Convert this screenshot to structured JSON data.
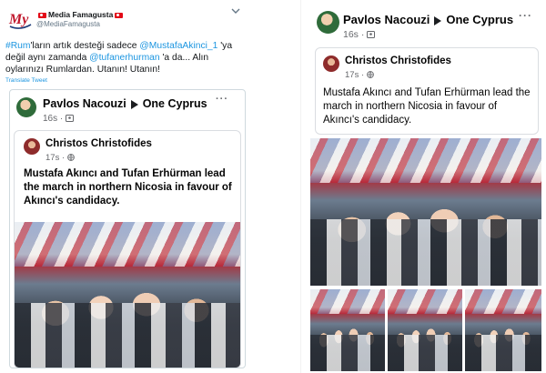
{
  "tweet": {
    "account_name": "Media Famagusta",
    "account_handle": "@MediaFamagusta",
    "logo_text": "My",
    "text_parts": [
      {
        "t": "#Rum",
        "link": true
      },
      {
        "t": "'ların artık desteği sadece ",
        "link": false
      },
      {
        "t": "@MustafaAkinci_1",
        "link": true
      },
      {
        "t": " 'ya değil aynı zamanda ",
        "link": false
      },
      {
        "t": "@tufanerhurman",
        "link": true
      },
      {
        "t": " 'a da... Alın oylarınızı Rumlardan. Utanın! Utanın!",
        "link": false
      }
    ],
    "translate_label": "Translate Tweet",
    "more_icon": "chevron-down-icon"
  },
  "fb_post": {
    "author": "Pavlos Nacouzi",
    "group": "One Cyprus",
    "time": "16s",
    "privacy_icon": "group-icon",
    "shared_author": "Christos Christofides",
    "shared_time": "17s",
    "shared_privacy_icon": "globe-icon",
    "body": "Mustafa Akıncı and Tufan Erhürman lead the march in northern Nicosia in favour of Akıncı's candidacy.",
    "more_icon": "ellipsis-icon"
  },
  "colors": {
    "twitter_link": "#1b95e0",
    "muted": "#657786",
    "fb_text": "#050505"
  }
}
